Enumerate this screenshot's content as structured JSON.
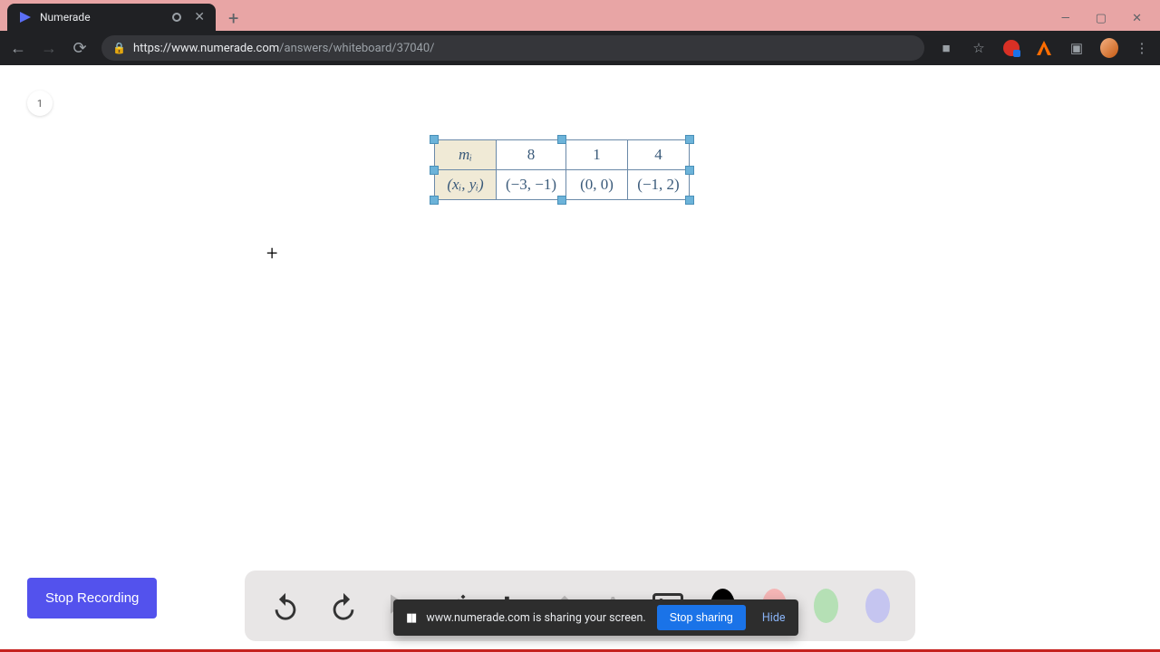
{
  "tab": {
    "title": "Numerade"
  },
  "url": {
    "host": "https://www.numerade.com",
    "path": "/answers/whiteboard/37040/"
  },
  "page_badge": "1",
  "table": {
    "r1": {
      "hdr": "mᵢ",
      "c1": "8",
      "c2": "1",
      "c3": "4"
    },
    "r2": {
      "hdr": "(xᵢ, yᵢ)",
      "c1": "(−3, −1)",
      "c2": "(0, 0)",
      "c3": "(−1, 2)"
    }
  },
  "stop_recording": "Stop Recording",
  "sharebar": {
    "msg": "www.numerade.com is sharing your screen.",
    "stop": "Stop sharing",
    "hide": "Hide"
  },
  "colors": {
    "black": "#000000",
    "pink": "#f4b5b5",
    "green": "#b5e0b5",
    "purple": "#c5c5f0"
  }
}
